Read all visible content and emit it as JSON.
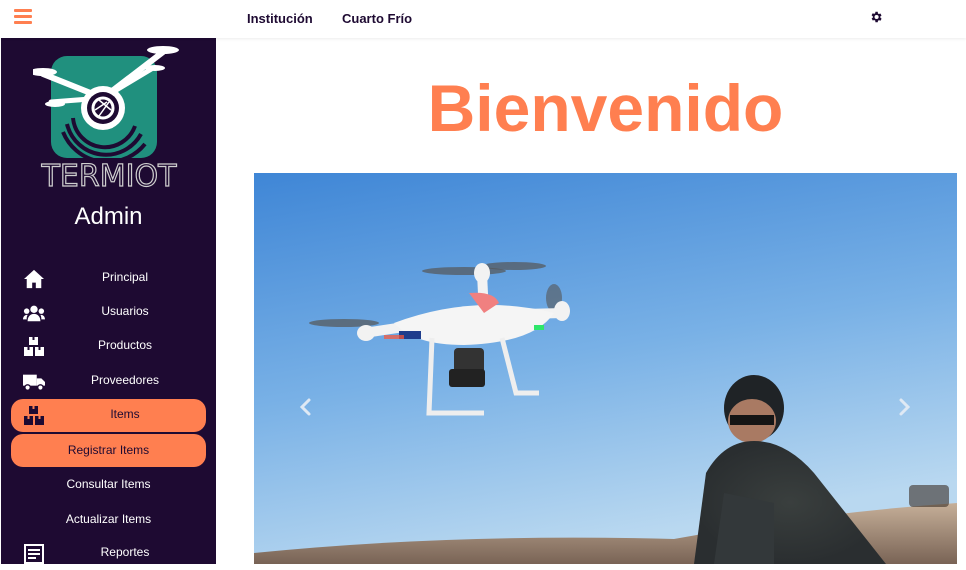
{
  "topbar": {
    "nav": [
      "Institución",
      "Cuarto Frío"
    ]
  },
  "sidebar": {
    "brand": "TERMIOT",
    "role": "Admin",
    "items": [
      {
        "label": "Principal",
        "icon": "home-icon"
      },
      {
        "label": "Usuarios",
        "icon": "users-icon"
      },
      {
        "label": "Productos",
        "icon": "boxes-icon"
      },
      {
        "label": "Proveedores",
        "icon": "truck-icon"
      },
      {
        "label": "Items",
        "icon": "boxes-icon"
      },
      {
        "label": "Registrar Items"
      },
      {
        "label": "Consultar Items"
      },
      {
        "label": "Actualizar Items"
      },
      {
        "label": "Reportes",
        "icon": "report-icon"
      }
    ]
  },
  "main": {
    "heading": "Bienvenido"
  },
  "colors": {
    "accent": "#ff7f50",
    "sidebar_bg": "#1e0a32",
    "logo_teal": "#20907e"
  }
}
